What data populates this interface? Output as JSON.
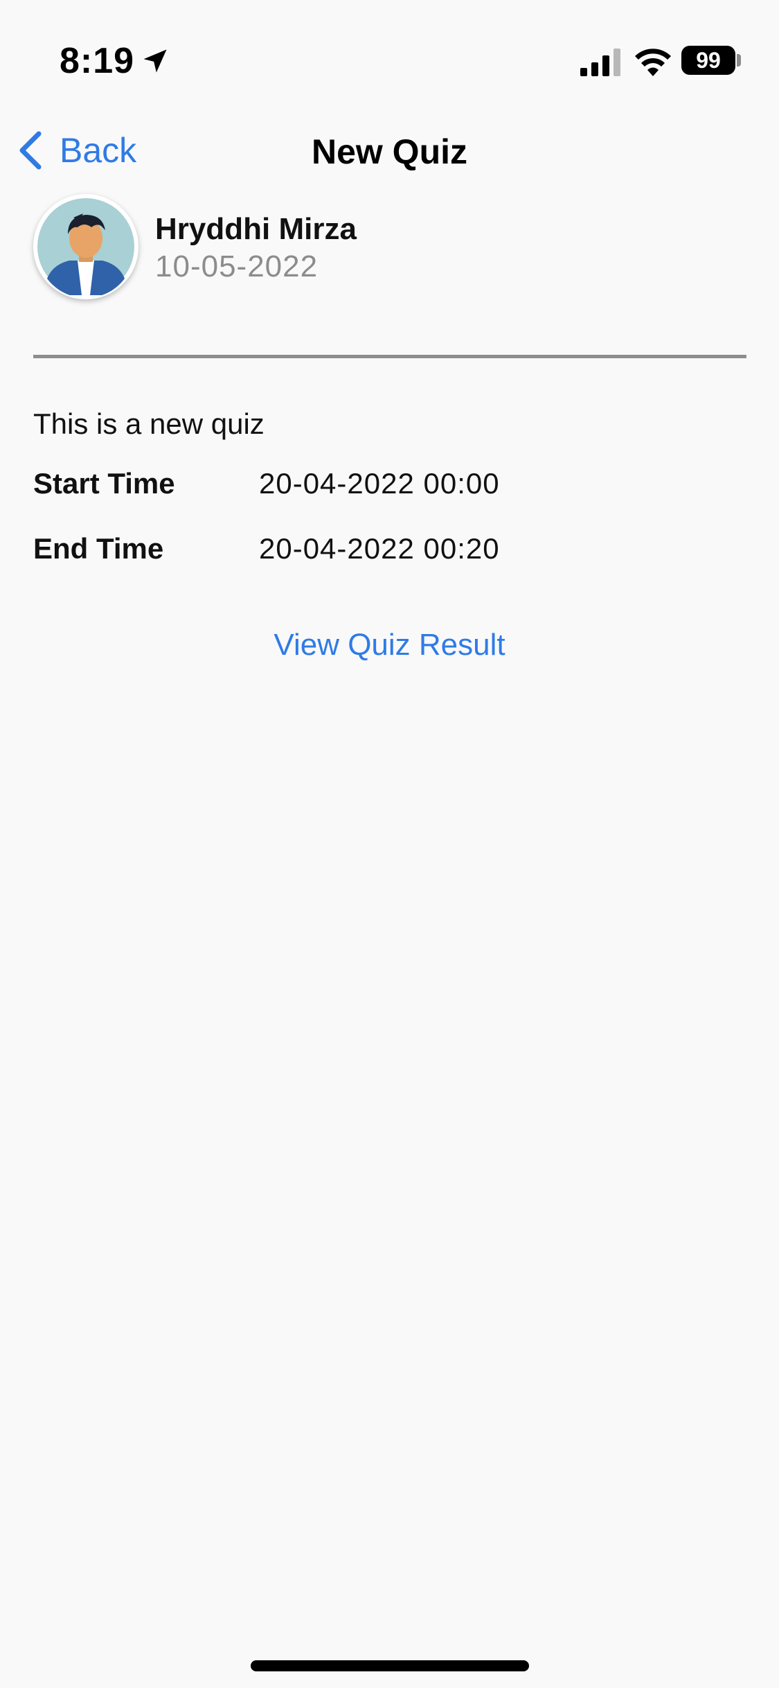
{
  "status_bar": {
    "time": "8:19",
    "battery_level": "99",
    "icons": [
      "location-arrow-icon",
      "cellular-signal-icon",
      "wifi-icon",
      "battery-icon"
    ]
  },
  "nav": {
    "back_label": "Back",
    "title": "New Quiz",
    "accent_color": "#2f7be5"
  },
  "author": {
    "name": "Hryddhi Mirza",
    "date": "10-05-2022",
    "avatar_icon": "user-avatar-icon"
  },
  "quiz": {
    "description": "This is a new quiz",
    "start": {
      "label": "Start Time",
      "value": "20-04-2022 00:00"
    },
    "end": {
      "label": "End Time",
      "value": "20-04-2022 00:20"
    },
    "result_link": "View Quiz Result"
  }
}
